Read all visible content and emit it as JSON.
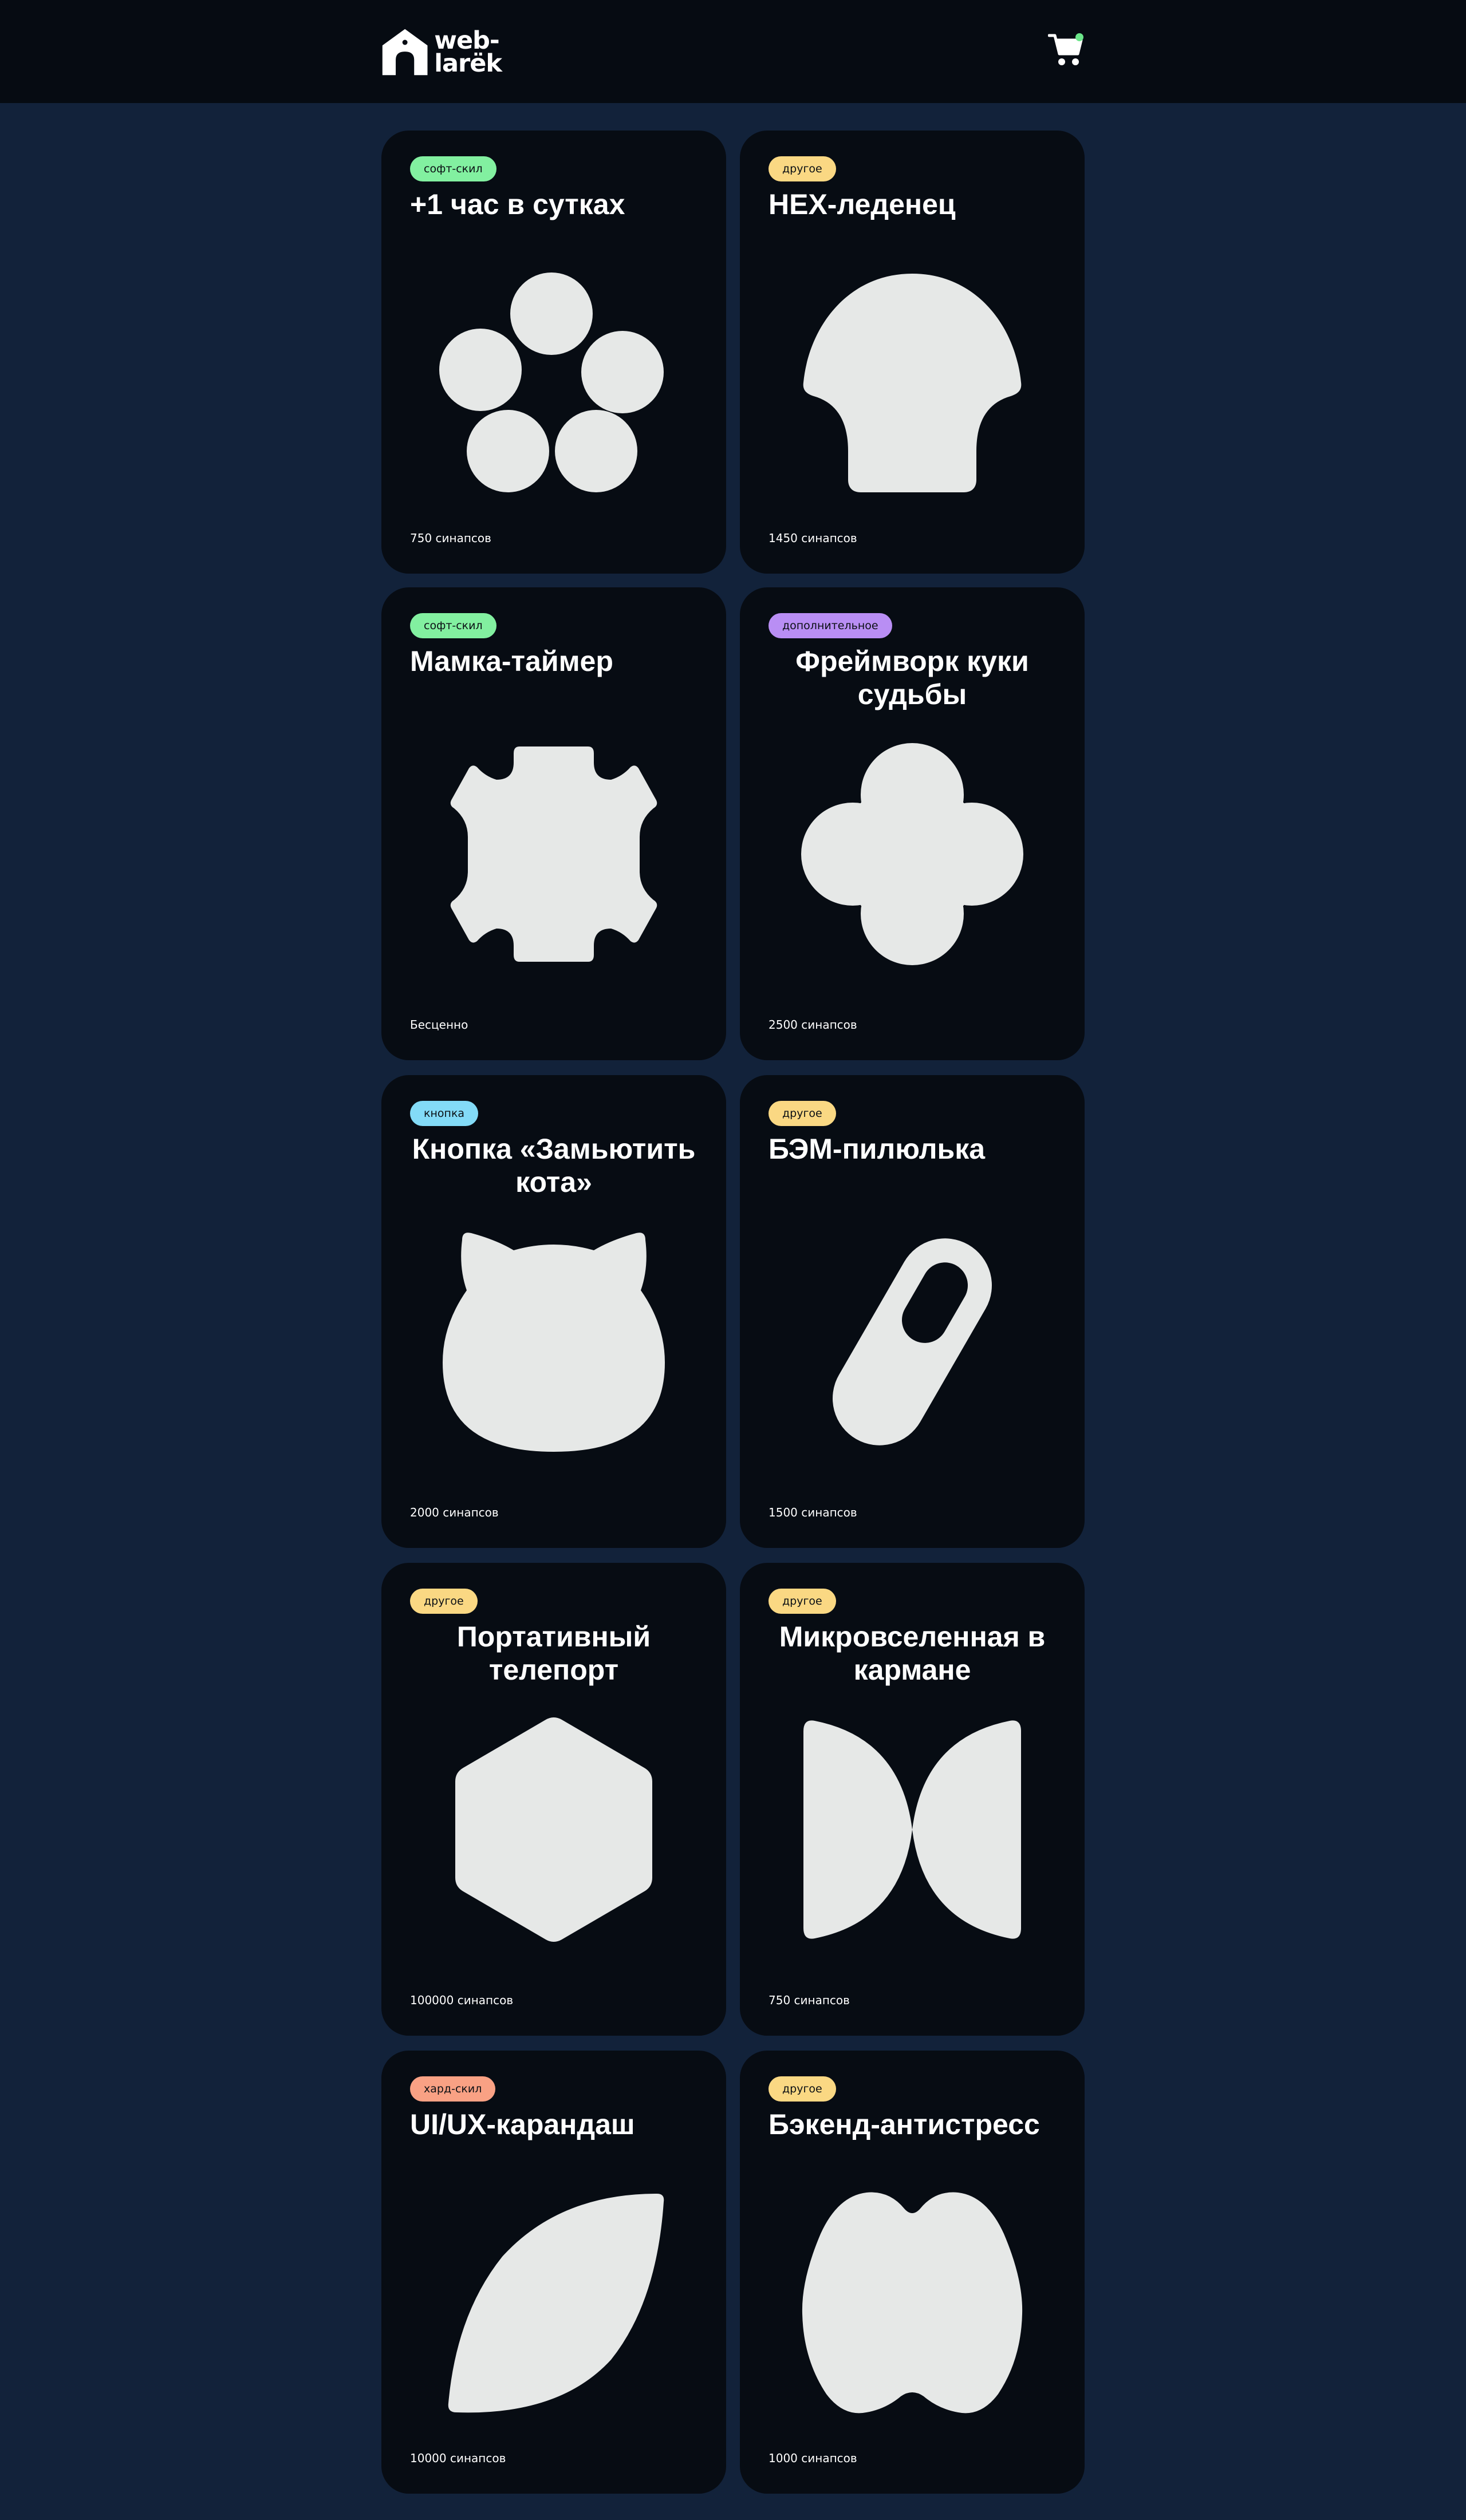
{
  "header": {
    "logo_line1": "web-",
    "logo_line2": "larёk",
    "cart_label": "cart-icon"
  },
  "colors": {
    "background": "#12223a",
    "card": "#070c13",
    "soft_skill": "#82f0a0",
    "other": "#fad883",
    "additional": "#b98ef4",
    "button": "#83dbf7",
    "hard_skill": "#f9a184"
  },
  "products": [
    {
      "category": "софт-скил",
      "title": "+1 час в сутках",
      "price": "750 синапсов",
      "icon": "circles-icon"
    },
    {
      "category": "другое",
      "title": "HEX-леденец",
      "price": "1450 синапсов",
      "icon": "lollipop-icon"
    },
    {
      "category": "софт-скил",
      "title": "Мамка-таймер",
      "price": "Бесценно",
      "icon": "gear-icon"
    },
    {
      "category": "дополнительное",
      "title": "Фреймворк куки судьбы",
      "price": "2500 синапсов",
      "icon": "clover-icon"
    },
    {
      "category": "кнопка",
      "title": "Кнопка «Замьютить кота»",
      "price": "2000 синапсов",
      "icon": "cat-icon"
    },
    {
      "category": "другое",
      "title": "БЭМ-пилюлька",
      "price": "1500 синапсов",
      "icon": "pill-icon"
    },
    {
      "category": "другое",
      "title": "Портативный телепорт",
      "price": "100000 синапсов",
      "icon": "hexagon-icon"
    },
    {
      "category": "другое",
      "title": "Микровселенная в кармане",
      "price": "750 синапсов",
      "icon": "butterfly-icon"
    },
    {
      "category": "хард-скил",
      "title": "UI/UX-карандаш",
      "price": "10000 синапсов",
      "icon": "leaf-icon"
    },
    {
      "category": "другое",
      "title": "Бэкенд-антистресс",
      "price": "1000 синапсов",
      "icon": "peanut-icon"
    }
  ]
}
